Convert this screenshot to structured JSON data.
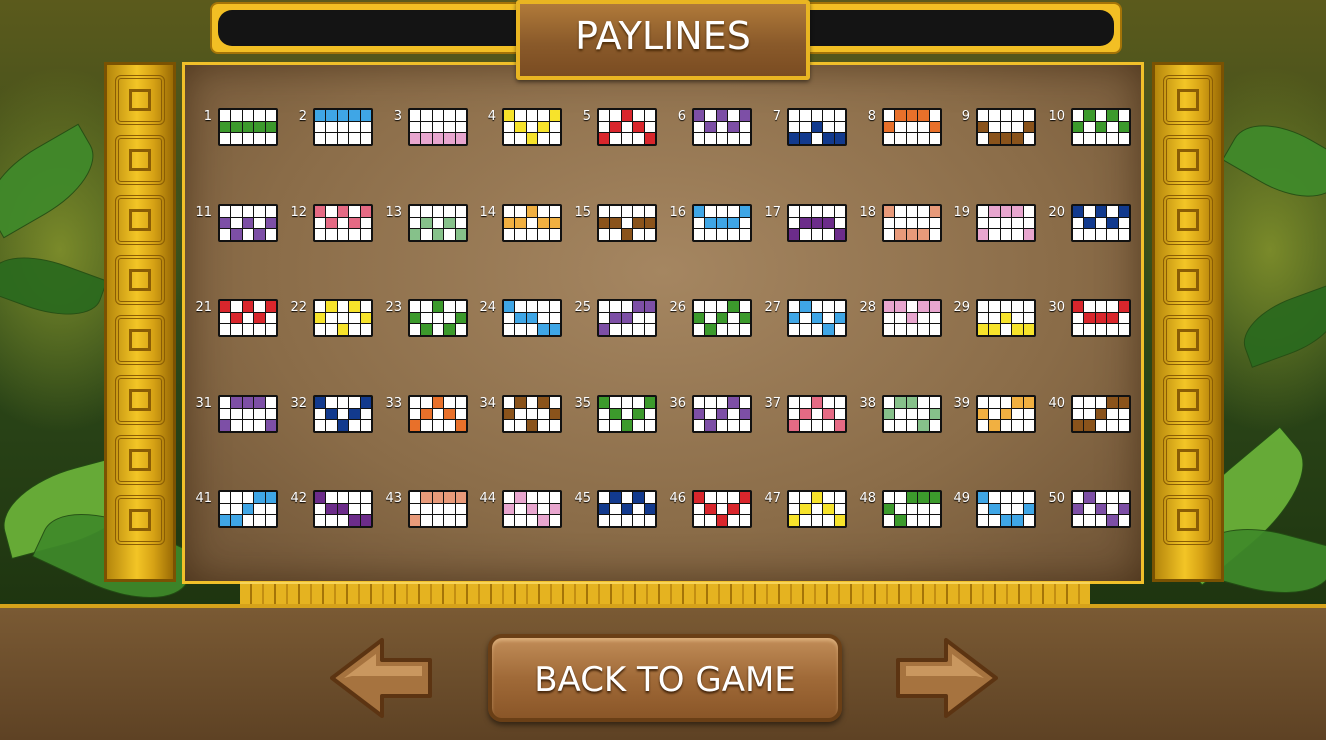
{
  "title": "PAYLINES",
  "back_label": "BACK TO GAME",
  "colors": {
    "green": "#3c9a2c",
    "blue": "#3fa6e6",
    "pink": "#e8a6cf",
    "yellow": "#f7e32b",
    "red": "#d9262c",
    "purple": "#7d4fa6",
    "navy": "#123a8e",
    "orange": "#e8702a",
    "brown": "#8a531b",
    "violet": "#6c2c8a",
    "salmon": "#e89a7a",
    "sage": "#86c18a",
    "amber": "#f1b041",
    "rose": "#e56a84"
  },
  "paylines": [
    {
      "n": "1",
      "color": "green",
      "rows": [
        1,
        1,
        1,
        1,
        1
      ]
    },
    {
      "n": "2",
      "color": "blue",
      "rows": [
        0,
        0,
        0,
        0,
        0
      ]
    },
    {
      "n": "3",
      "color": "pink",
      "rows": [
        2,
        2,
        2,
        2,
        2
      ]
    },
    {
      "n": "4",
      "color": "yellow",
      "rows": [
        0,
        1,
        2,
        1,
        0
      ]
    },
    {
      "n": "5",
      "color": "red",
      "rows": [
        2,
        1,
        0,
        1,
        2
      ]
    },
    {
      "n": "6",
      "color": "purple",
      "rows": [
        0,
        1,
        0,
        1,
        0
      ]
    },
    {
      "n": "7",
      "color": "navy",
      "rows": [
        2,
        2,
        1,
        2,
        2
      ]
    },
    {
      "n": "8",
      "color": "orange",
      "rows": [
        1,
        0,
        0,
        0,
        1
      ]
    },
    {
      "n": "9",
      "color": "brown",
      "rows": [
        1,
        2,
        2,
        2,
        1
      ]
    },
    {
      "n": "10",
      "color": "green",
      "rows": [
        1,
        0,
        1,
        0,
        1
      ]
    },
    {
      "n": "11",
      "color": "purple",
      "rows": [
        1,
        2,
        1,
        2,
        1
      ]
    },
    {
      "n": "12",
      "color": "rose",
      "rows": [
        0,
        1,
        0,
        1,
        0
      ]
    },
    {
      "n": "13",
      "color": "sage",
      "rows": [
        2,
        1,
        2,
        1,
        2
      ]
    },
    {
      "n": "14",
      "color": "amber",
      "rows": [
        1,
        1,
        0,
        1,
        1
      ]
    },
    {
      "n": "15",
      "color": "brown",
      "rows": [
        1,
        1,
        2,
        1,
        1
      ]
    },
    {
      "n": "16",
      "color": "blue",
      "rows": [
        0,
        1,
        1,
        1,
        0
      ]
    },
    {
      "n": "17",
      "color": "violet",
      "rows": [
        2,
        1,
        1,
        1,
        2
      ]
    },
    {
      "n": "18",
      "color": "salmon",
      "rows": [
        0,
        2,
        2,
        2,
        0
      ]
    },
    {
      "n": "19",
      "color": "pink",
      "rows": [
        2,
        0,
        0,
        0,
        2
      ]
    },
    {
      "n": "20",
      "color": "navy",
      "rows": [
        0,
        1,
        0,
        1,
        0
      ]
    },
    {
      "n": "21",
      "color": "red",
      "rows": [
        0,
        1,
        0,
        1,
        0
      ]
    },
    {
      "n": "22",
      "color": "yellow",
      "rows": [
        1,
        0,
        2,
        0,
        1
      ]
    },
    {
      "n": "23",
      "color": "green",
      "rows": [
        1,
        2,
        0,
        2,
        1
      ]
    },
    {
      "n": "24",
      "color": "blue",
      "rows": [
        0,
        1,
        1,
        2,
        2
      ]
    },
    {
      "n": "25",
      "color": "purple",
      "rows": [
        2,
        1,
        1,
        0,
        0
      ]
    },
    {
      "n": "26",
      "color": "green",
      "rows": [
        1,
        2,
        1,
        0,
        1
      ]
    },
    {
      "n": "27",
      "color": "blue",
      "rows": [
        1,
        0,
        1,
        2,
        1
      ]
    },
    {
      "n": "28",
      "color": "pink",
      "rows": [
        0,
        0,
        1,
        0,
        0
      ]
    },
    {
      "n": "29",
      "color": "yellow",
      "rows": [
        2,
        2,
        1,
        2,
        2
      ]
    },
    {
      "n": "30",
      "color": "red",
      "rows": [
        0,
        1,
        1,
        1,
        0
      ]
    },
    {
      "n": "31",
      "color": "purple",
      "rows": [
        2,
        0,
        0,
        0,
        2
      ]
    },
    {
      "n": "32",
      "color": "navy",
      "rows": [
        0,
        1,
        2,
        1,
        0
      ]
    },
    {
      "n": "33",
      "color": "orange",
      "rows": [
        2,
        1,
        0,
        1,
        2
      ]
    },
    {
      "n": "34",
      "color": "brown",
      "rows": [
        1,
        0,
        2,
        0,
        1
      ]
    },
    {
      "n": "35",
      "color": "green",
      "rows": [
        0,
        1,
        2,
        1,
        0
      ]
    },
    {
      "n": "36",
      "color": "purple",
      "rows": [
        1,
        2,
        1,
        0,
        1
      ]
    },
    {
      "n": "37",
      "color": "rose",
      "rows": [
        2,
        1,
        0,
        1,
        2
      ]
    },
    {
      "n": "38",
      "color": "sage",
      "rows": [
        1,
        0,
        0,
        2,
        1
      ]
    },
    {
      "n": "39",
      "color": "amber",
      "rows": [
        1,
        2,
        1,
        0,
        0
      ]
    },
    {
      "n": "40",
      "color": "brown",
      "rows": [
        2,
        2,
        1,
        0,
        0
      ]
    },
    {
      "n": "41",
      "color": "blue",
      "rows": [
        2,
        2,
        1,
        0,
        0
      ]
    },
    {
      "n": "42",
      "color": "violet",
      "rows": [
        0,
        1,
        1,
        2,
        2
      ]
    },
    {
      "n": "43",
      "color": "salmon",
      "rows": [
        2,
        0,
        0,
        0,
        0
      ]
    },
    {
      "n": "44",
      "color": "pink",
      "rows": [
        1,
        0,
        1,
        2,
        1
      ]
    },
    {
      "n": "45",
      "color": "navy",
      "rows": [
        1,
        0,
        1,
        0,
        1
      ]
    },
    {
      "n": "46",
      "color": "red",
      "rows": [
        0,
        1,
        2,
        1,
        0
      ]
    },
    {
      "n": "47",
      "color": "yellow",
      "rows": [
        2,
        1,
        0,
        1,
        2
      ]
    },
    {
      "n": "48",
      "color": "green",
      "rows": [
        1,
        2,
        0,
        0,
        0
      ]
    },
    {
      "n": "49",
      "color": "blue",
      "rows": [
        0,
        1,
        2,
        2,
        1
      ]
    },
    {
      "n": "50",
      "color": "purple",
      "rows": [
        1,
        0,
        1,
        2,
        1
      ]
    }
  ]
}
